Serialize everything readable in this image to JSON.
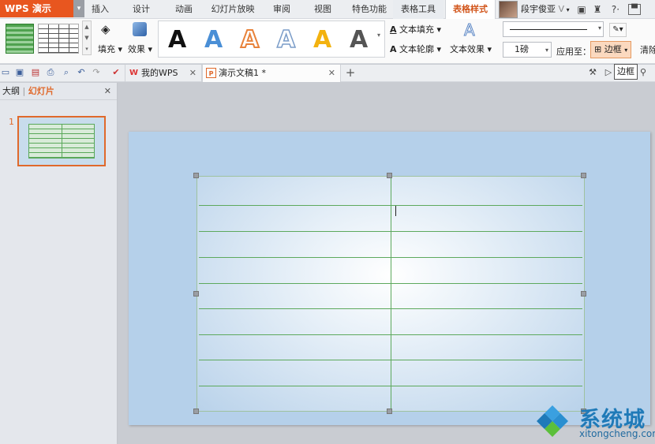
{
  "app": {
    "name": "WPS 演示"
  },
  "ribbon_tabs": [
    {
      "label": "插入"
    },
    {
      "label": "设计"
    },
    {
      "label": "动画"
    },
    {
      "label": "幻灯片放映"
    },
    {
      "label": "审阅"
    },
    {
      "label": "视图"
    },
    {
      "label": "特色功能"
    },
    {
      "label": "表格工具"
    },
    {
      "label": "表格样式"
    }
  ],
  "active_tab": "表格样式",
  "user": {
    "name": "段宇俊亚"
  },
  "title_icons": [
    "box-icon",
    "shirt-icon",
    "help-icon",
    "minimize-icon"
  ],
  "ribbon": {
    "fill_label": "填充",
    "effect_label": "效果",
    "wordart_letter": "A",
    "wordart_colors": [
      "#111111",
      "#4a8fd6",
      "#e8823a",
      "#ffffff",
      "#f3b20f",
      "#555555"
    ],
    "text_fill_label": "文本填充",
    "text_outline_label": "文本轮廓",
    "text_effect_label": "文本效果",
    "line_weight": "1磅",
    "apply_to_label": "应用至：",
    "border_label": "边框",
    "clear_label": "清除"
  },
  "tooltip": "边框",
  "doc_tabs": [
    {
      "label": "我的WPS",
      "icon": "W"
    },
    {
      "label": "演示文稿1 *",
      "icon": "P"
    }
  ],
  "panel": {
    "outline_tab": "大纲",
    "slides_tab": "幻灯片",
    "slide_number": "1"
  },
  "table": {
    "rows": 9,
    "cols": 2,
    "border_color": "#5da95d"
  },
  "watermark": {
    "brand": "系统城",
    "url": "xitongcheng.com"
  }
}
